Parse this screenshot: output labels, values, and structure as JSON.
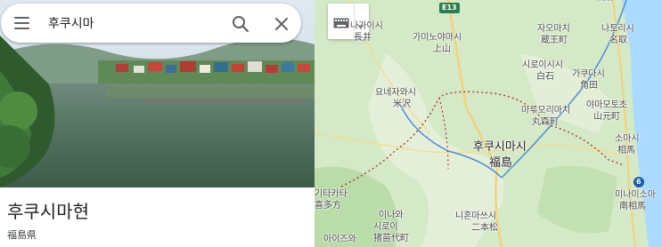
{
  "search": {
    "value": "후쿠시마",
    "menu_icon": "menu-icon",
    "search_icon": "search-icon",
    "close_icon": "close-icon"
  },
  "place": {
    "title": "후쿠시마현",
    "subtitle": "福島県"
  },
  "map_controls": {
    "keyboard_icon": "keyboard-icon",
    "dropdown_icon": "chevron-down-icon"
  },
  "map": {
    "labels": {
      "nagai": "나가이시",
      "nagai_jp": "長井",
      "kaminoyama": "가미노야마시",
      "kaminoyama_jp": "上山",
      "zao": "자오마치",
      "zao_jp": "蔵王町",
      "natori": "나토리시",
      "natori_jp": "名取",
      "shiroishi": "시로이시시",
      "shiroishi_jp": "白石",
      "kakuda": "가쿠다시",
      "kakuda_jp": "角田",
      "yonezawa": "요네자와시",
      "yonezawa_jp": "米沢",
      "marumori": "마루모리마치",
      "marumori_jp": "丸森町",
      "yamamoto": "야마모토초",
      "yamamoto_jp": "山元町",
      "fukushima": "후쿠시마시",
      "fukushima_jp": "福島",
      "soma": "소마시",
      "soma_jp": "相馬",
      "kitakata": "기타카타",
      "kitakata_jp": "喜多方",
      "minamisoma": "미나미소마",
      "minamisoma_jp": "南相馬",
      "inawashiro": "이나와",
      "inawashiro_jp": "시로이",
      "inawashiro_jp2": "猪苗代町",
      "nihonmatsu": "니혼마쓰시",
      "nihonmatsu_jp": "二本松",
      "aizu": "아이즈와",
      "sendai_top": "仙台"
    },
    "shields": {
      "e13": "E13",
      "route6": "6"
    },
    "colors": {
      "land": "#cfe7c2",
      "sea": "#aadaff",
      "boundary": "#c0392b",
      "rail": "#4a8fd6",
      "road": "#f3d27a"
    }
  }
}
